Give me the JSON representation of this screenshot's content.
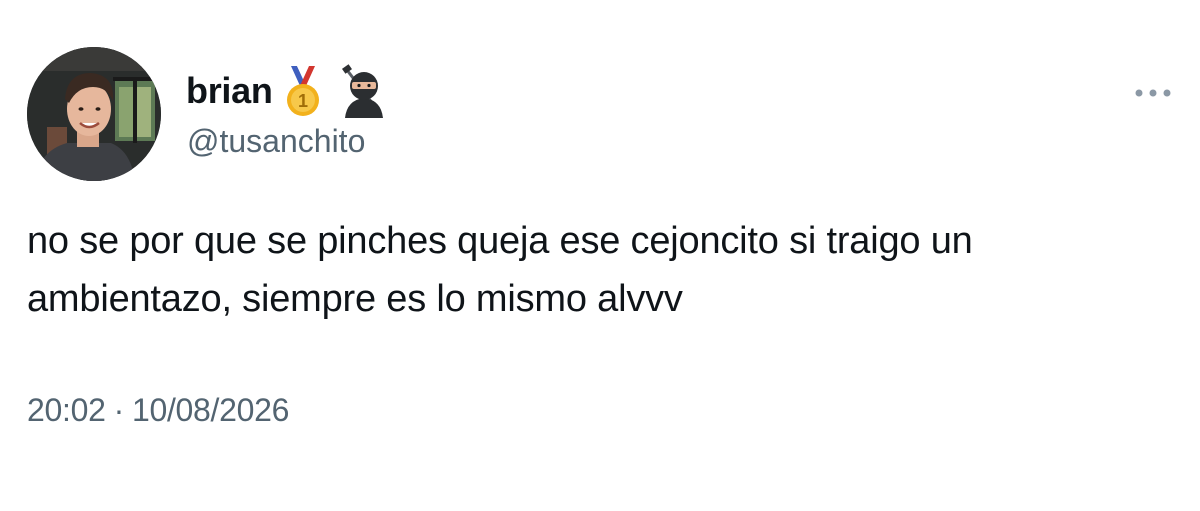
{
  "user": {
    "display_name": "brian",
    "handle": "@tusanchito",
    "avatar_icon": "profile-photo",
    "badges": [
      "first-place-medal-icon",
      "ninja-icon"
    ]
  },
  "tweet": {
    "text_line_1": "no se por que se pinches queja ese cejoncito si traigo un",
    "text_line_2": "ambientazo, siempre es lo mismo alvvv",
    "time": "20:02",
    "separator": "·",
    "date": "10/08/2026"
  },
  "icons": {
    "more": "more-dots-icon"
  },
  "colors": {
    "text_primary": "#0f1419",
    "text_secondary": "#536471",
    "medal_gold": "#f2b11c",
    "ribbon_blue": "#3f5fbf",
    "ribbon_red": "#d2362f"
  }
}
